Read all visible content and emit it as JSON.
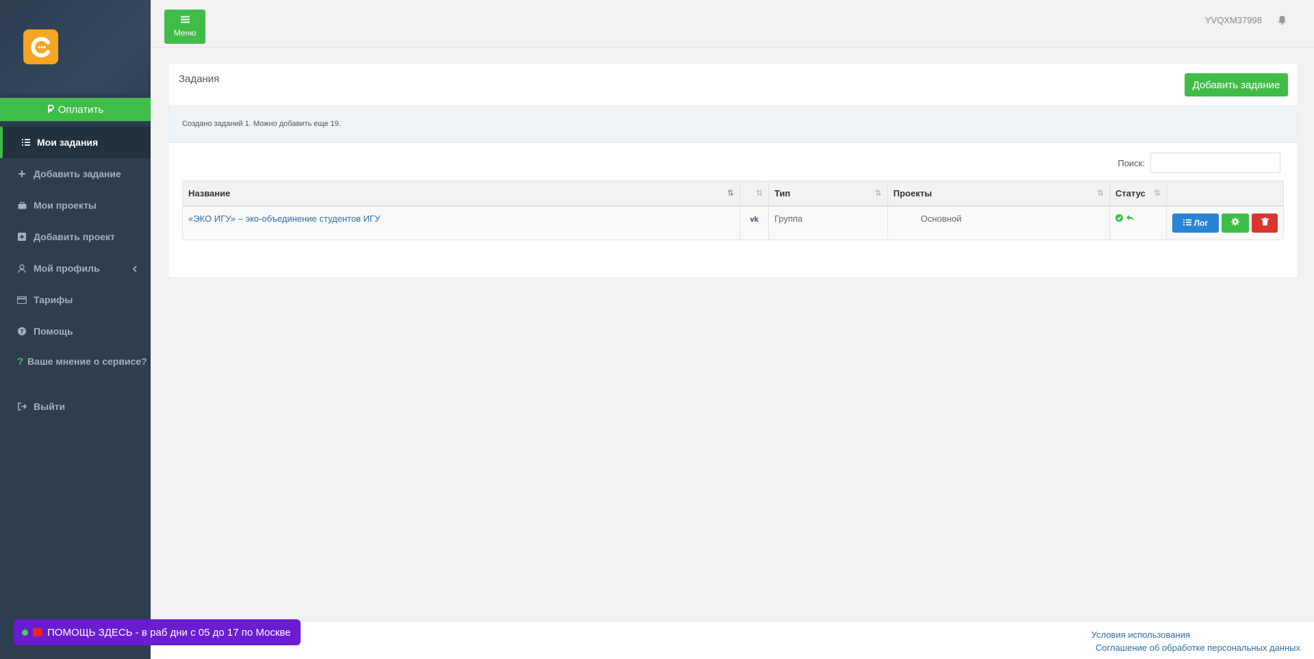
{
  "sidebar": {
    "pay_label": "Оплатить",
    "items": [
      {
        "label": "Мои задания",
        "icon": "tasks-icon"
      },
      {
        "label": "Добавить задание",
        "icon": "plus-icon"
      },
      {
        "label": "Мои проекты",
        "icon": "briefcase-icon"
      },
      {
        "label": "Добавить проект",
        "icon": "plus-square-icon"
      },
      {
        "label": "Мой профиль",
        "icon": "user-icon"
      },
      {
        "label": "Тарифы",
        "icon": "credit-card-icon"
      },
      {
        "label": "Помощь",
        "icon": "question-circle-icon"
      },
      {
        "label": "Ваше мнение о сервисе?",
        "icon": "question-icon"
      },
      {
        "label": "Выйти",
        "icon": "sign-out-icon"
      }
    ]
  },
  "topbar": {
    "menu_label": "Меню",
    "username": "YVQXM37998"
  },
  "panel": {
    "title": "Задания",
    "add_button": "Добавить задание",
    "info": "Создано заданий 1. Можно добавить еще 19.",
    "search_label": "Поиск:",
    "search_value": ""
  },
  "table": {
    "headers": {
      "name": "Название",
      "type": "Тип",
      "projects": "Проекты",
      "status": "Статус"
    },
    "rows": [
      {
        "name": "«ЭКО ИГУ» – эко-объединение студентов ИГУ",
        "network": "vk-icon",
        "type": "Группа",
        "project": "Основной",
        "log_label": "Лог"
      }
    ]
  },
  "footer": {
    "terms": "Условия использования",
    "privacy": "Соглашение об обработке персональных данных"
  },
  "help_pill": {
    "text": "ПОМОЩЬ ЗДЕСЬ - в раб дни с 05 до 17 по Москве"
  },
  "colors": {
    "sidebar": "#2c3e50",
    "accent_green": "#3fbd48",
    "blue": "#2985d4",
    "red": "#d9362f",
    "purple": "#6a1cd0",
    "logo_orange": "#f5a623"
  }
}
